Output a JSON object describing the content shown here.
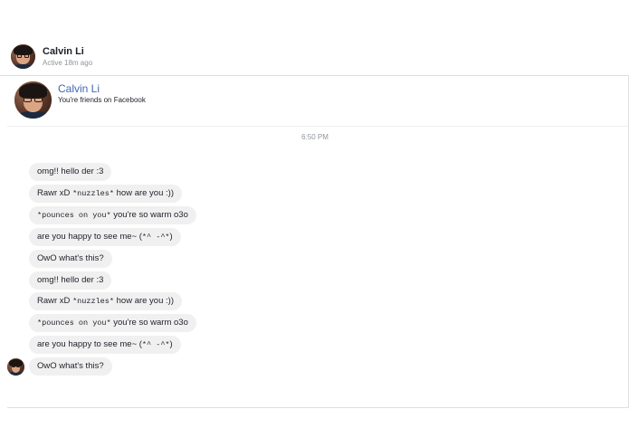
{
  "header": {
    "name": "Calvin Li",
    "status": "Active 18m ago"
  },
  "intro": {
    "name": "Calvin Li",
    "friends_text": "You're friends on Facebook"
  },
  "timestamp": "6:50 PM",
  "messages": [
    {
      "parts": [
        "omg!! hello der :3"
      ]
    },
    {
      "parts": [
        "Rawr xD ",
        "*nuzzles*",
        " how are you :))"
      ]
    },
    {
      "parts": [
        "*pounces on you*",
        " you're so warm o3o"
      ]
    },
    {
      "parts": [
        "are you happy to see me~ (",
        "*^ -^*",
        ")"
      ]
    },
    {
      "parts": [
        "OwO what's this?"
      ]
    },
    {
      "parts": [
        "omg!! hello der :3"
      ]
    },
    {
      "parts": [
        "Rawr xD ",
        "*nuzzles*",
        " how are you :))"
      ]
    },
    {
      "parts": [
        "*pounces on you*",
        " you're so warm o3o"
      ]
    },
    {
      "parts": [
        "are you happy to see me~ (",
        "*^ -^*",
        ")"
      ]
    },
    {
      "parts": [
        "OwO what's this?"
      ]
    }
  ],
  "colors": {
    "bubble": "#f1f0f0",
    "link_blue": "#4267b2",
    "muted": "#90949c"
  },
  "icons": [
    "avatar-photo"
  ]
}
